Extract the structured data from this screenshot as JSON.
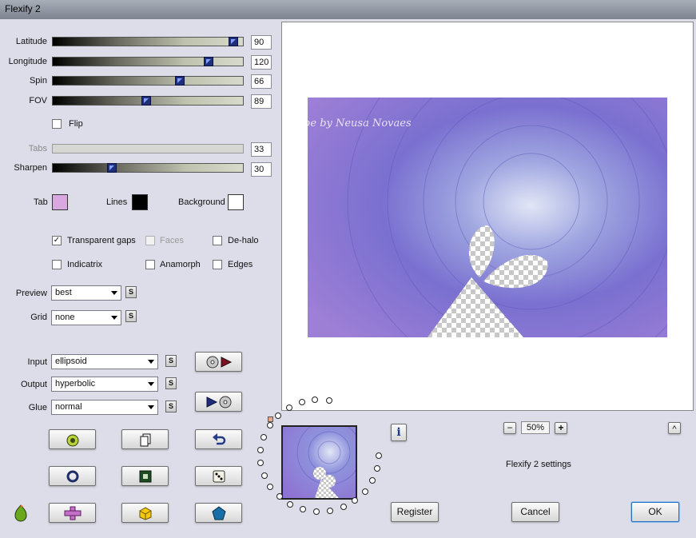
{
  "window": {
    "title": "Flexify 2"
  },
  "sliders": [
    {
      "label": "Latitude",
      "value": "90",
      "fraction": 0.95
    },
    {
      "label": "Longitude",
      "value": "120",
      "fraction": 0.82
    },
    {
      "label": "Spin",
      "value": "66",
      "fraction": 0.67
    },
    {
      "label": "FOV",
      "value": "89",
      "fraction": 0.49
    }
  ],
  "flip": {
    "label": "Flip",
    "checked": false
  },
  "tabs": {
    "label": "Tabs",
    "value": "33"
  },
  "sharpen": {
    "label": "Sharpen",
    "value": "30",
    "fraction": 0.31
  },
  "colors": {
    "tab": {
      "label": "Tab",
      "color": "#d9a8e0"
    },
    "lines": {
      "label": "Lines",
      "color": "#000000"
    },
    "background": {
      "label": "Background",
      "color": "#ffffff"
    }
  },
  "options": {
    "transparent_gaps": {
      "label": "Transparent gaps",
      "checked": true
    },
    "faces": {
      "label": "Faces",
      "checked": false
    },
    "dehalo": {
      "label": "De-halo",
      "checked": false
    },
    "indicatrix": {
      "label": "Indicatrix",
      "checked": false
    },
    "anamorph": {
      "label": "Anamorph",
      "checked": false
    },
    "edges": {
      "label": "Edges",
      "checked": false
    }
  },
  "preview": {
    "label": "Preview",
    "value": "best"
  },
  "grid": {
    "label": "Grid",
    "value": "none"
  },
  "input": {
    "label": "Input",
    "value": "ellipsoid"
  },
  "output": {
    "label": "Output",
    "value": "hyperbolic"
  },
  "glue": {
    "label": "Glue",
    "value": "normal"
  },
  "s_label": "S",
  "watermark": "Tube by Neusa Novaes",
  "zoom": {
    "value": "50%",
    "minus": "−",
    "plus": "+"
  },
  "settings_title": "Flexify 2 settings",
  "buttons": {
    "register": "Register",
    "cancel": "Cancel",
    "ok": "OK",
    "info": "i",
    "up": "^"
  }
}
